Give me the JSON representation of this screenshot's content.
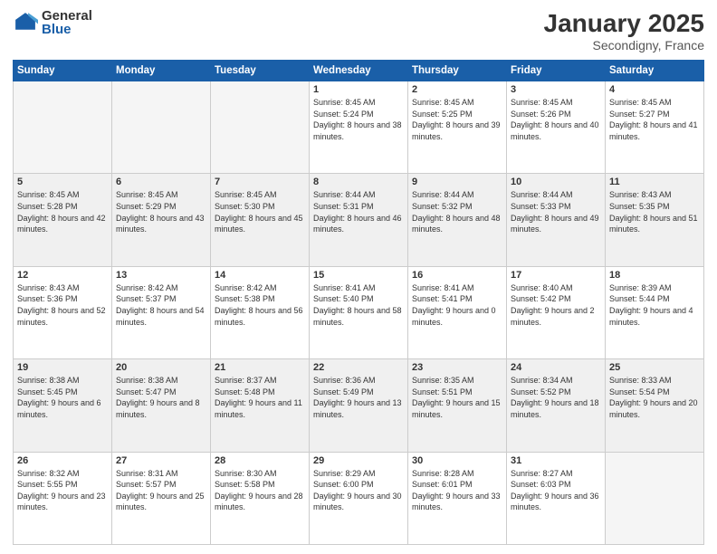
{
  "logo": {
    "general": "General",
    "blue": "Blue"
  },
  "title": "January 2025",
  "subtitle": "Secondigny, France",
  "days_header": [
    "Sunday",
    "Monday",
    "Tuesday",
    "Wednesday",
    "Thursday",
    "Friday",
    "Saturday"
  ],
  "weeks": [
    [
      {
        "day": "",
        "empty": true
      },
      {
        "day": "",
        "empty": true
      },
      {
        "day": "",
        "empty": true
      },
      {
        "day": "1",
        "sunrise": "8:45 AM",
        "sunset": "5:24 PM",
        "daylight": "8 hours and 38 minutes."
      },
      {
        "day": "2",
        "sunrise": "8:45 AM",
        "sunset": "5:25 PM",
        "daylight": "8 hours and 39 minutes."
      },
      {
        "day": "3",
        "sunrise": "8:45 AM",
        "sunset": "5:26 PM",
        "daylight": "8 hours and 40 minutes."
      },
      {
        "day": "4",
        "sunrise": "8:45 AM",
        "sunset": "5:27 PM",
        "daylight": "8 hours and 41 minutes."
      }
    ],
    [
      {
        "day": "5",
        "sunrise": "8:45 AM",
        "sunset": "5:28 PM",
        "daylight": "8 hours and 42 minutes."
      },
      {
        "day": "6",
        "sunrise": "8:45 AM",
        "sunset": "5:29 PM",
        "daylight": "8 hours and 43 minutes."
      },
      {
        "day": "7",
        "sunrise": "8:45 AM",
        "sunset": "5:30 PM",
        "daylight": "8 hours and 45 minutes."
      },
      {
        "day": "8",
        "sunrise": "8:44 AM",
        "sunset": "5:31 PM",
        "daylight": "8 hours and 46 minutes."
      },
      {
        "day": "9",
        "sunrise": "8:44 AM",
        "sunset": "5:32 PM",
        "daylight": "8 hours and 48 minutes."
      },
      {
        "day": "10",
        "sunrise": "8:44 AM",
        "sunset": "5:33 PM",
        "daylight": "8 hours and 49 minutes."
      },
      {
        "day": "11",
        "sunrise": "8:43 AM",
        "sunset": "5:35 PM",
        "daylight": "8 hours and 51 minutes."
      }
    ],
    [
      {
        "day": "12",
        "sunrise": "8:43 AM",
        "sunset": "5:36 PM",
        "daylight": "8 hours and 52 minutes."
      },
      {
        "day": "13",
        "sunrise": "8:42 AM",
        "sunset": "5:37 PM",
        "daylight": "8 hours and 54 minutes."
      },
      {
        "day": "14",
        "sunrise": "8:42 AM",
        "sunset": "5:38 PM",
        "daylight": "8 hours and 56 minutes."
      },
      {
        "day": "15",
        "sunrise": "8:41 AM",
        "sunset": "5:40 PM",
        "daylight": "8 hours and 58 minutes."
      },
      {
        "day": "16",
        "sunrise": "8:41 AM",
        "sunset": "5:41 PM",
        "daylight": "9 hours and 0 minutes."
      },
      {
        "day": "17",
        "sunrise": "8:40 AM",
        "sunset": "5:42 PM",
        "daylight": "9 hours and 2 minutes."
      },
      {
        "day": "18",
        "sunrise": "8:39 AM",
        "sunset": "5:44 PM",
        "daylight": "9 hours and 4 minutes."
      }
    ],
    [
      {
        "day": "19",
        "sunrise": "8:38 AM",
        "sunset": "5:45 PM",
        "daylight": "9 hours and 6 minutes."
      },
      {
        "day": "20",
        "sunrise": "8:38 AM",
        "sunset": "5:47 PM",
        "daylight": "9 hours and 8 minutes."
      },
      {
        "day": "21",
        "sunrise": "8:37 AM",
        "sunset": "5:48 PM",
        "daylight": "9 hours and 11 minutes."
      },
      {
        "day": "22",
        "sunrise": "8:36 AM",
        "sunset": "5:49 PM",
        "daylight": "9 hours and 13 minutes."
      },
      {
        "day": "23",
        "sunrise": "8:35 AM",
        "sunset": "5:51 PM",
        "daylight": "9 hours and 15 minutes."
      },
      {
        "day": "24",
        "sunrise": "8:34 AM",
        "sunset": "5:52 PM",
        "daylight": "9 hours and 18 minutes."
      },
      {
        "day": "25",
        "sunrise": "8:33 AM",
        "sunset": "5:54 PM",
        "daylight": "9 hours and 20 minutes."
      }
    ],
    [
      {
        "day": "26",
        "sunrise": "8:32 AM",
        "sunset": "5:55 PM",
        "daylight": "9 hours and 23 minutes."
      },
      {
        "day": "27",
        "sunrise": "8:31 AM",
        "sunset": "5:57 PM",
        "daylight": "9 hours and 25 minutes."
      },
      {
        "day": "28",
        "sunrise": "8:30 AM",
        "sunset": "5:58 PM",
        "daylight": "9 hours and 28 minutes."
      },
      {
        "day": "29",
        "sunrise": "8:29 AM",
        "sunset": "6:00 PM",
        "daylight": "9 hours and 30 minutes."
      },
      {
        "day": "30",
        "sunrise": "8:28 AM",
        "sunset": "6:01 PM",
        "daylight": "9 hours and 33 minutes."
      },
      {
        "day": "31",
        "sunrise": "8:27 AM",
        "sunset": "6:03 PM",
        "daylight": "9 hours and 36 minutes."
      },
      {
        "day": "",
        "empty": true
      }
    ]
  ]
}
